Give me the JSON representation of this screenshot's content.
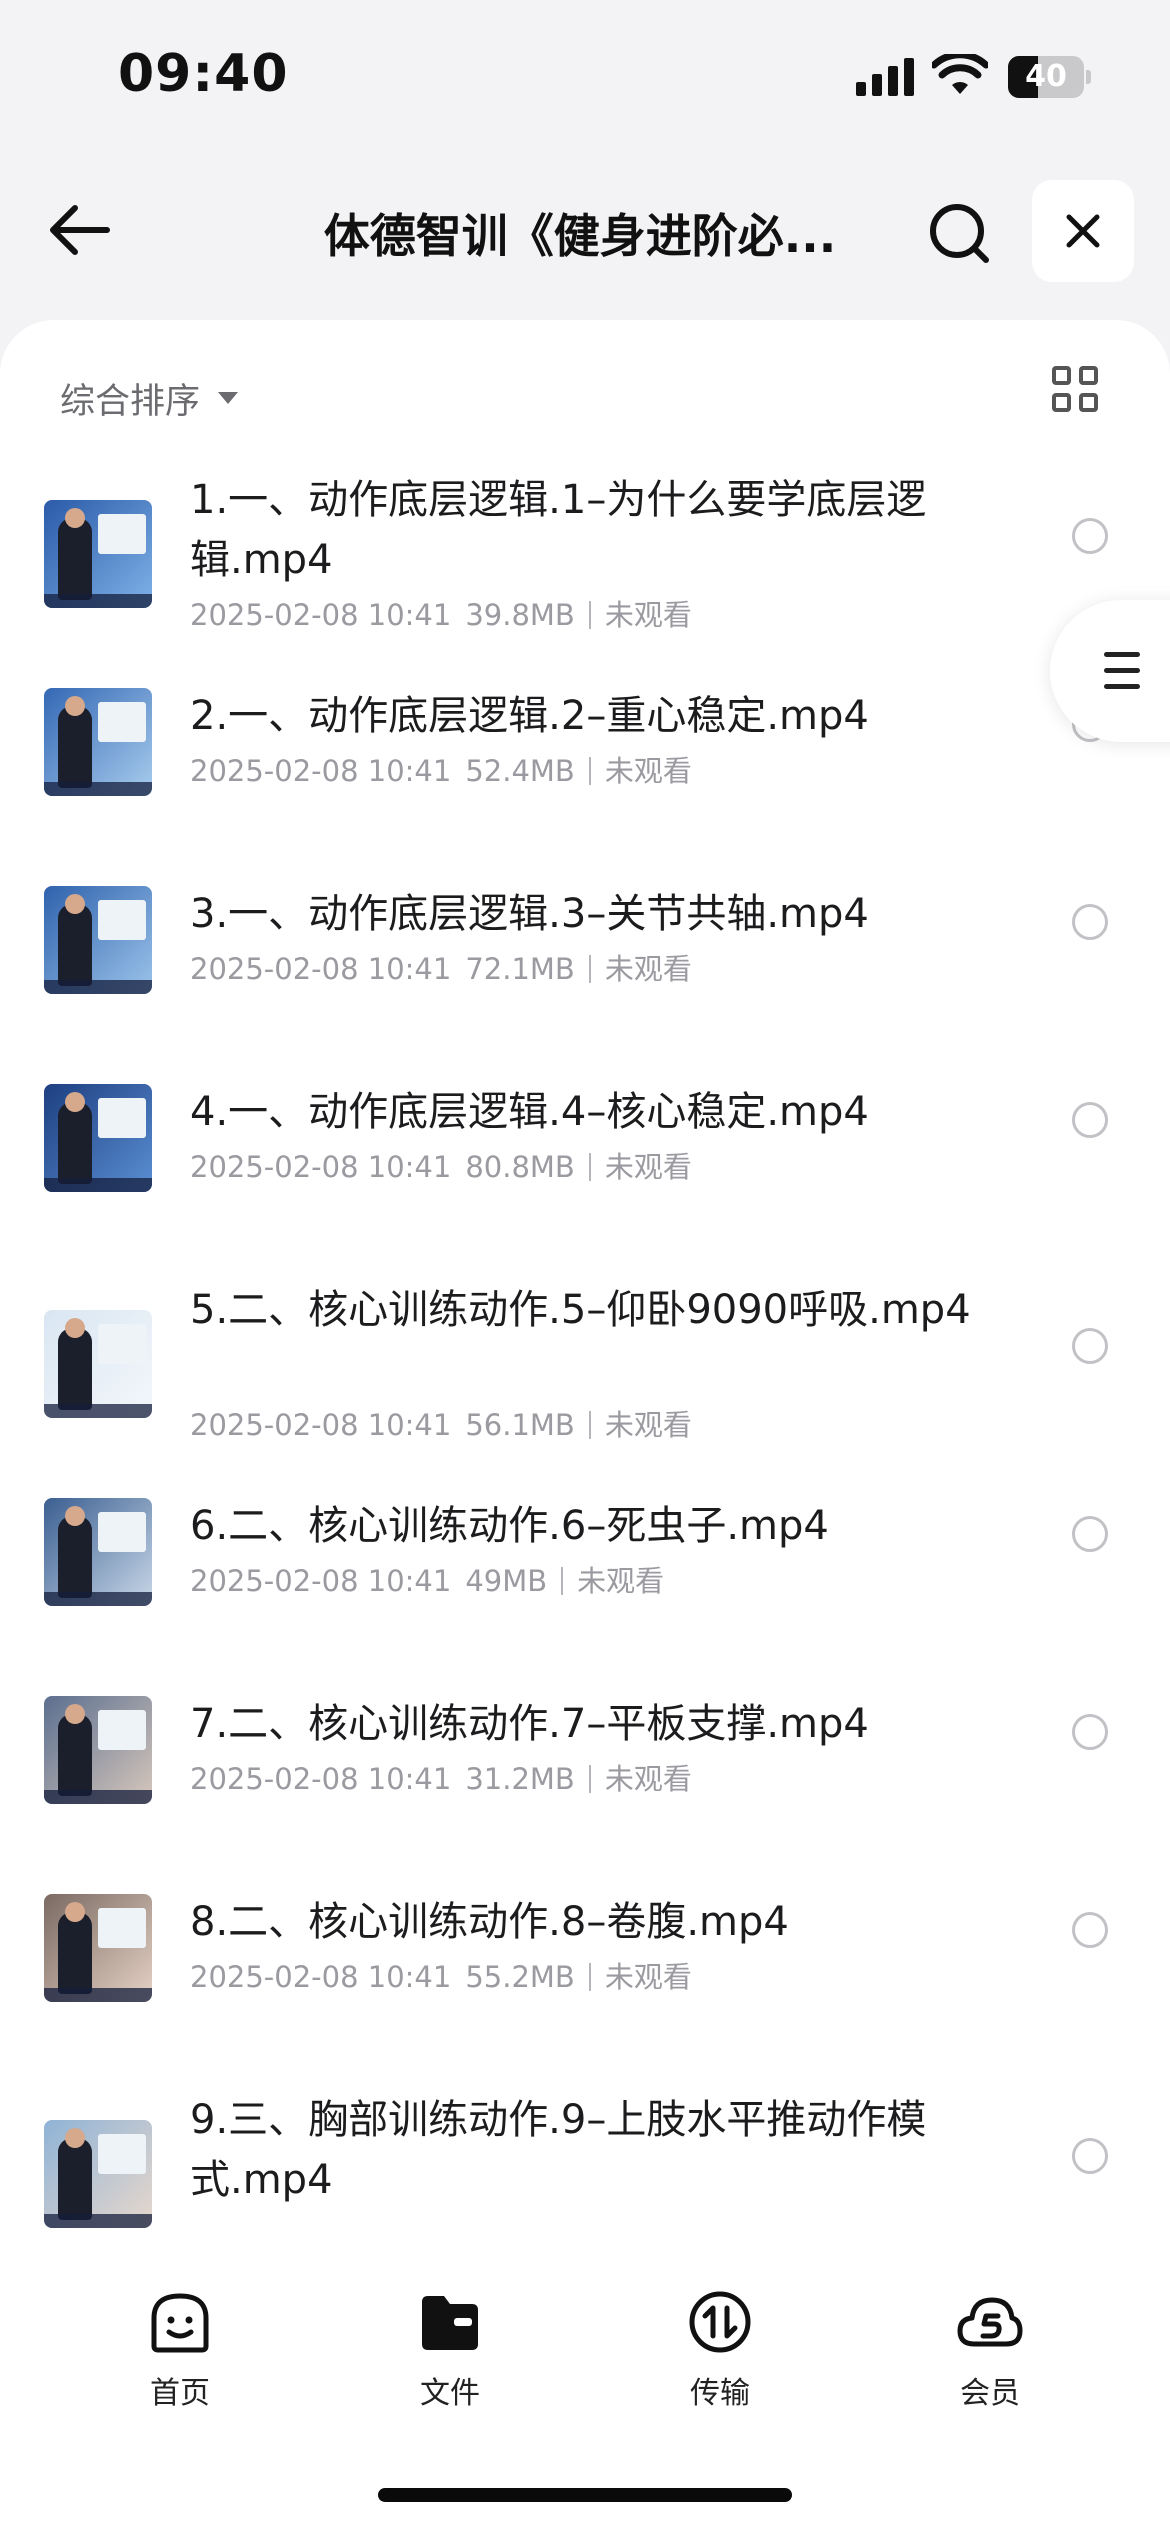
{
  "status_bar": {
    "time": "09:40",
    "battery_level": "40",
    "battery_fraction": 0.4
  },
  "header": {
    "title": "体德智训《健身进阶必...",
    "icons": {
      "back": "back-arrow-icon",
      "search": "search-icon",
      "close": "close-icon"
    }
  },
  "toolbar": {
    "sort_label": "综合排序",
    "view_toggle_icon": "grid-view-icon"
  },
  "side_handle": {
    "icon": "menu-icon"
  },
  "files": [
    {
      "name": "1.一、动作底层逻辑.1–为什么要学底层逻辑.mp4",
      "date": "2025-02-08 10:41",
      "size": "39.8MB",
      "status": "未观看"
    },
    {
      "name": "2.一、动作底层逻辑.2–重心稳定.mp4",
      "date": "2025-02-08 10:41",
      "size": "52.4MB",
      "status": "未观看"
    },
    {
      "name": "3.一、动作底层逻辑.3–关节共轴.mp4",
      "date": "2025-02-08 10:41",
      "size": "72.1MB",
      "status": "未观看"
    },
    {
      "name": "4.一、动作底层逻辑.4–核心稳定.mp4",
      "date": "2025-02-08 10:41",
      "size": "80.8MB",
      "status": "未观看"
    },
    {
      "name": "5.二、核心训练动作.5–仰卧9090呼吸.mp4",
      "date": "2025-02-08 10:41",
      "size": "56.1MB",
      "status": "未观看"
    },
    {
      "name": "6.二、核心训练动作.6–死虫子.mp4",
      "date": "2025-02-08 10:41",
      "size": "49MB",
      "status": "未观看"
    },
    {
      "name": "7.二、核心训练动作.7–平板支撑.mp4",
      "date": "2025-02-08 10:41",
      "size": "31.2MB",
      "status": "未观看"
    },
    {
      "name": "8.二、核心训练动作.8–卷腹.mp4",
      "date": "2025-02-08 10:41",
      "size": "55.2MB",
      "status": "未观看"
    },
    {
      "name": "9.三、胸部训练动作.9–上肢水平推动作模式.mp4",
      "date": "",
      "size": "",
      "status": ""
    }
  ],
  "bottom_nav": [
    {
      "label": "首页",
      "icon": "smiley-home-icon"
    },
    {
      "label": "文件",
      "icon": "folder-icon"
    },
    {
      "label": "传输",
      "icon": "transfer-icon"
    },
    {
      "label": "会员",
      "icon": "cloud-member-icon"
    }
  ]
}
